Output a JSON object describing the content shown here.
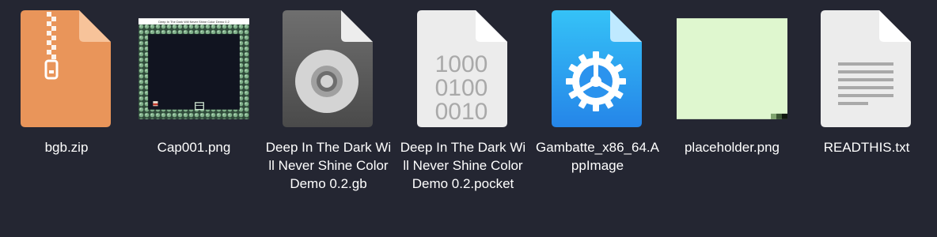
{
  "files": [
    {
      "name": "bgb.zip",
      "icon": "zip-archive-icon"
    },
    {
      "name": "Cap001.png",
      "icon": "image-thumbnail-icon"
    },
    {
      "name": "Deep In The Dark Will Never Shine Color Demo 0.2.gb",
      "icon": "disc-file-icon"
    },
    {
      "name": "Deep In The Dark Will Never Shine Color Demo 0.2.pocket",
      "icon": "binary-file-icon"
    },
    {
      "name": "Gambatte_x86_64.AppImage",
      "icon": "executable-gear-icon"
    },
    {
      "name": "placeholder.png",
      "icon": "image-thumbnail-icon"
    },
    {
      "name": "READTHIS.txt",
      "icon": "text-file-icon"
    }
  ],
  "thumbnail_caption": "Deep In The Dark Will Never Shine Color Demo 0.2",
  "binary_digits": [
    "1000",
    "0100",
    "0010"
  ],
  "colors": {
    "background": "#242632",
    "zip": "#e9955a",
    "appimage": "#2a9ff0",
    "placeholder": "#dff7cf"
  }
}
